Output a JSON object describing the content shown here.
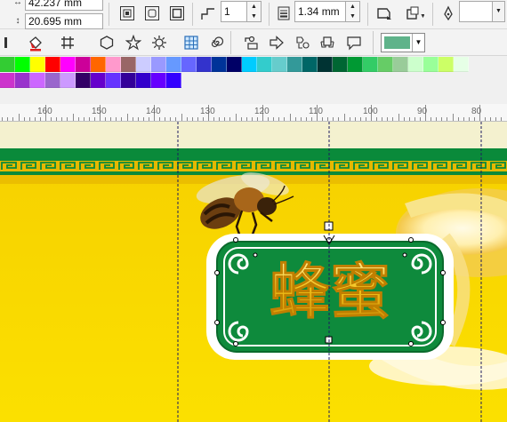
{
  "property_bar": {
    "width_value": "42.237 mm",
    "height_value": "20.695 mm",
    "corner_value": "1",
    "outline_width": "1.34 mm"
  },
  "toolbar": {
    "tools": [
      "fill-icon",
      "pattern-icon",
      "polygon-icon",
      "star-icon",
      "gear-icon",
      "table-icon",
      "spiral-icon",
      "basic-shapes-icon",
      "arrow-shapes-icon",
      "flowchart-icon",
      "banner-icon",
      "callout-icon"
    ],
    "fill_color": "#5fb38a"
  },
  "palette": {
    "row1": [
      "#33cc33",
      "#00ff00",
      "#ffff00",
      "#ff0000",
      "#ff00ff",
      "#cc0099",
      "#ff6600",
      "#ff99cc",
      "#996666",
      "#ccccff",
      "#9999ff",
      "#6699ff",
      "#6666ff",
      "#3333cc",
      "#003399",
      "#000066",
      "#00ccff",
      "#33cccc",
      "#66cccc",
      "#339999",
      "#006666",
      "#003333",
      "#006633",
      "#009933",
      "#33cc66",
      "#66cc66",
      "#99cc99",
      "#ccffcc",
      "#99ff99",
      "#ccff66",
      "#e6ffe6"
    ],
    "row2": [
      "#cc33cc",
      "#9933cc",
      "#cc66ff",
      "#9966cc",
      "#cc99ff",
      "#330066",
      "#6600cc",
      "#6633ff",
      "#330099",
      "#3300cc",
      "#6600ff",
      "#3300ff"
    ]
  },
  "ruler": {
    "labels": [
      "160",
      "150",
      "140",
      "130",
      "120",
      "110",
      "100",
      "90",
      "80"
    ]
  },
  "artwork": {
    "label_text": "蜂蜜"
  }
}
